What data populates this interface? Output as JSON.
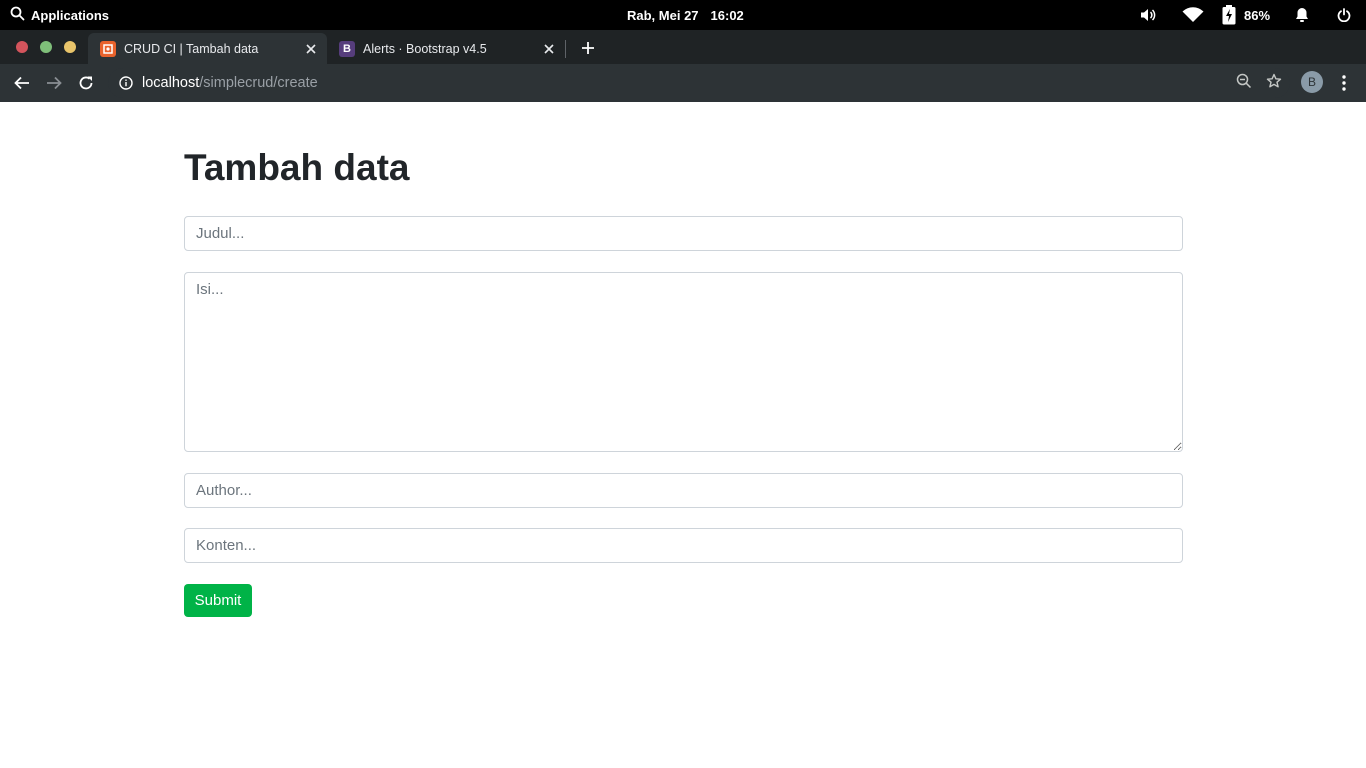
{
  "system_bar": {
    "applications_label": "Applications",
    "date": "Rab, Mei 27",
    "time": "16:02",
    "battery_percent": "86%"
  },
  "browser": {
    "tabs": [
      {
        "title": "CRUD CI | Tambah data",
        "active": true,
        "favicon_color": "#e8622c"
      },
      {
        "title": "Alerts · Bootstrap v4.5",
        "active": false,
        "favicon_color": "#563d7c",
        "favicon_letter": "B"
      }
    ],
    "url_host": "localhost",
    "url_path": "/simplecrud/create",
    "profile_initial": "B"
  },
  "form": {
    "heading": "Tambah data",
    "judul_placeholder": "Judul...",
    "isi_placeholder": "Isi...",
    "author_placeholder": "Author...",
    "konten_placeholder": "Konten...",
    "submit_label": "Submit"
  },
  "colors": {
    "submit_bg": "#00b347",
    "system_bar_bg": "#000000",
    "tabstrip_bg": "#1f2325",
    "toolbar_bg": "#2d3336"
  }
}
